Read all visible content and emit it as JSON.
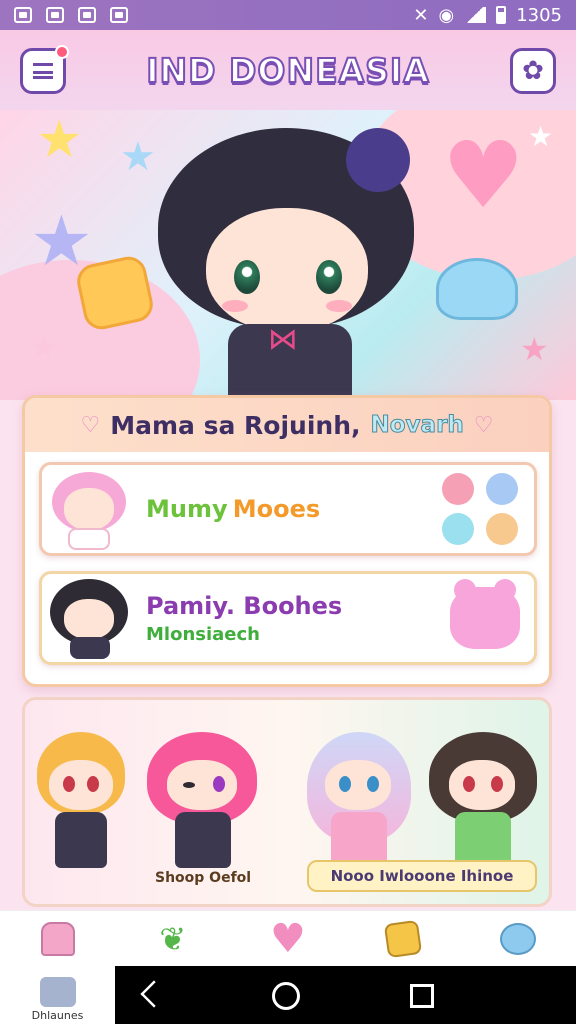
{
  "status_bar": {
    "time": "1305"
  },
  "header": {
    "title": "IND DONEASIA",
    "menu_icon": "menu-icon",
    "settings_icon": "flower-settings-icon"
  },
  "card": {
    "title_part1": "Mama sa Rojuinh,",
    "title_part2": "Novarh",
    "items": [
      {
        "title_part1": "Mumy",
        "title_part2": "Mooes",
        "title_color1": "#6cc23b",
        "title_color2": "#f39a2b",
        "decor_colors": [
          "#f6a0b5",
          "#a9c9f5",
          "#9be0ee",
          "#f8c98e"
        ]
      },
      {
        "title": "Pamiy. Boohes",
        "subtitle": "Mlonsiaech",
        "title_color": "#8a3cb0"
      }
    ]
  },
  "group": {
    "caption_left": "Shoop Oefol",
    "caption_right": "Nooo Iwlooone Ihinoe"
  },
  "tabbar": {
    "tabs": [
      "ice-cream-icon",
      "leaf-icon",
      "heart-icon",
      "cookie-icon",
      "bear-icon"
    ]
  },
  "system_nav": {
    "home_label": "Dhlaunes"
  }
}
